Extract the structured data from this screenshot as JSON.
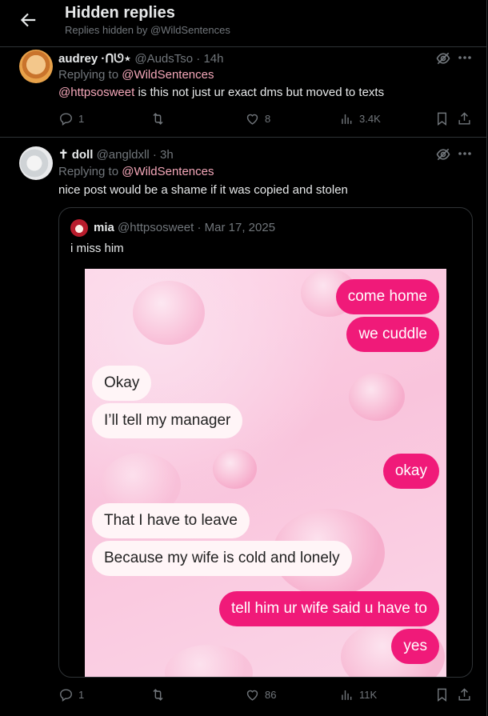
{
  "header": {
    "title": "Hidden replies",
    "subtitle": "Replies hidden by @WildSentences"
  },
  "posts": [
    {
      "name": "audrey ·ᑎᘎ⋆",
      "handle": "@AudsTso",
      "time": "· 14h",
      "replying_label": "Replying to ",
      "replying_to": "@WildSentences",
      "mention": "@httpsosweet",
      "text": " is this not just ur exact dms but moved to texts",
      "replies": "1",
      "reposts": "",
      "likes": "8",
      "views": "3.4K"
    },
    {
      "name": "✝ doll",
      "handle": "@angldxll",
      "time": "· 3h",
      "replying_label": "Replying to ",
      "replying_to": "@WildSentences",
      "text": "nice post would be a shame if it was copied and stolen",
      "replies": "1",
      "reposts": "",
      "likes": "86",
      "views": "11K"
    }
  ],
  "quote": {
    "name": "mia",
    "handle": "@httpsosweet",
    "date": "· Mar 17, 2025",
    "text": "i miss him",
    "messages": [
      {
        "side": "out",
        "text": "come home"
      },
      {
        "side": "out",
        "text": "we cuddle"
      },
      {
        "side": "in",
        "text": "Okay"
      },
      {
        "side": "in",
        "text": "I’ll tell my manager"
      },
      {
        "side": "out",
        "text": "okay"
      },
      {
        "side": "in",
        "text": "That I have to leave"
      },
      {
        "side": "in",
        "text": "Because my wife is cold and lonely"
      },
      {
        "side": "out",
        "text": "tell him ur wife said u have to"
      },
      {
        "side": "out",
        "text": "yes"
      }
    ]
  },
  "icons": {
    "back": "arrow-left-icon",
    "hidden": "eye-slash-icon",
    "more": "more-icon",
    "reply": "reply-icon",
    "repost": "repost-icon",
    "like": "heart-icon",
    "views": "views-icon",
    "bookmark": "bookmark-icon",
    "share": "share-icon"
  },
  "colors": {
    "background": "#000000",
    "mention": "#f4a7b9",
    "muted": "#71767b",
    "bubble_out": "#f01a79",
    "bubble_in": "#fff5f7"
  }
}
